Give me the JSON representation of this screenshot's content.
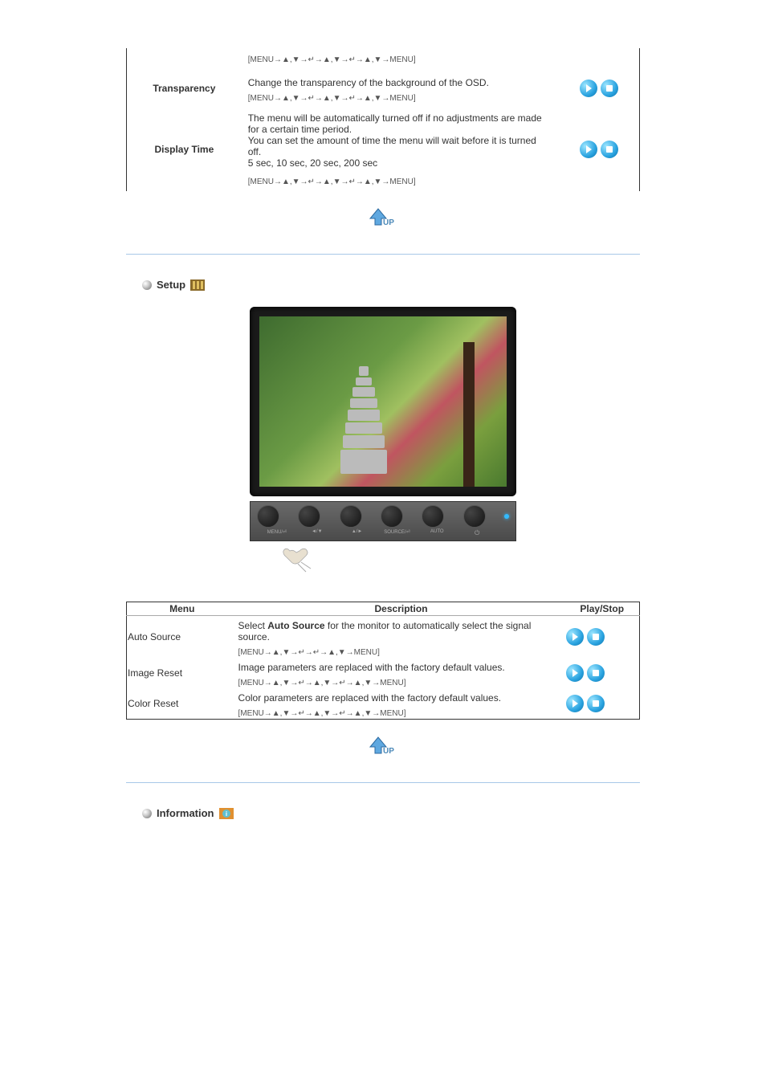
{
  "table1": {
    "row0": {
      "path_before": "[MENU→▲,▼→↵→▲,▼→↵→▲,▼→MENU]"
    },
    "row1": {
      "label": "Transparency",
      "desc": "Change the transparency of the background of the OSD.",
      "path": "[MENU→▲,▼→↵→▲,▼→↵→▲,▼→MENU]"
    },
    "row2": {
      "label": "Display Time",
      "desc1": "The menu will be automatically turned off if no adjustments are made for a certain time period.",
      "desc2": "You can set the amount of time the menu will wait before it is turned off.",
      "desc3": "5 sec, 10 sec, 20 sec, 200 sec",
      "path": "[MENU→▲,▼→↵→▲,▼→↵→▲,▼→MENU]"
    }
  },
  "section_setup": "Setup",
  "panel_labels": {
    "l1": "MENU/⏎",
    "l2": "◄/▼",
    "l3": "▲/►",
    "l4": "SOURCE/⏎",
    "l5": "AUTO",
    "l6": "⏻"
  },
  "table2": {
    "hdr_menu": "Menu",
    "hdr_desc": "Description",
    "hdr_play": "Play/Stop",
    "row1": {
      "label": "Auto Source",
      "desc_a": "Select ",
      "desc_b": "Auto Source",
      "desc_c": " for the monitor to automatically select the signal source.",
      "path": "[MENU→▲,▼→↵→↵→▲,▼→MENU]"
    },
    "row2": {
      "label": "Image Reset",
      "desc": "Image parameters are replaced with the factory default values.",
      "path": "[MENU→▲,▼→↵→▲,▼→↵→▲,▼→MENU]"
    },
    "row3": {
      "label": "Color Reset",
      "desc": "Color parameters are replaced with the factory default values.",
      "path": "[MENU→▲,▼→↵→▲,▼→↵→▲,▼→MENU]"
    }
  },
  "section_info": "Information"
}
